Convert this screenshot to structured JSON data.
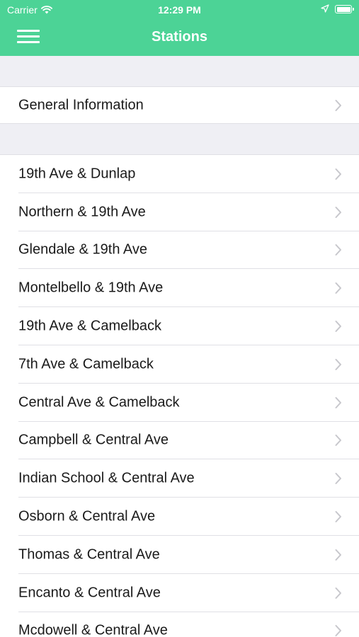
{
  "status_bar": {
    "carrier": "Carrier",
    "time": "12:29 PM"
  },
  "nav": {
    "title": "Stations"
  },
  "general_row": {
    "label": "General Information"
  },
  "stations": [
    {
      "label": "19th Ave & Dunlap"
    },
    {
      "label": "Northern & 19th Ave"
    },
    {
      "label": "Glendale & 19th Ave"
    },
    {
      "label": "Montelbello & 19th Ave"
    },
    {
      "label": "19th Ave & Camelback"
    },
    {
      "label": "7th Ave & Camelback"
    },
    {
      "label": "Central Ave & Camelback"
    },
    {
      "label": "Campbell & Central Ave"
    },
    {
      "label": "Indian School & Central Ave"
    },
    {
      "label": "Osborn & Central Ave"
    },
    {
      "label": "Thomas & Central Ave"
    },
    {
      "label": "Encanto & Central Ave"
    },
    {
      "label": "Mcdowell & Central Ave"
    }
  ],
  "colors": {
    "accent": "#4cd396",
    "background": "#efeff4",
    "chevron": "#c7c7cc"
  }
}
